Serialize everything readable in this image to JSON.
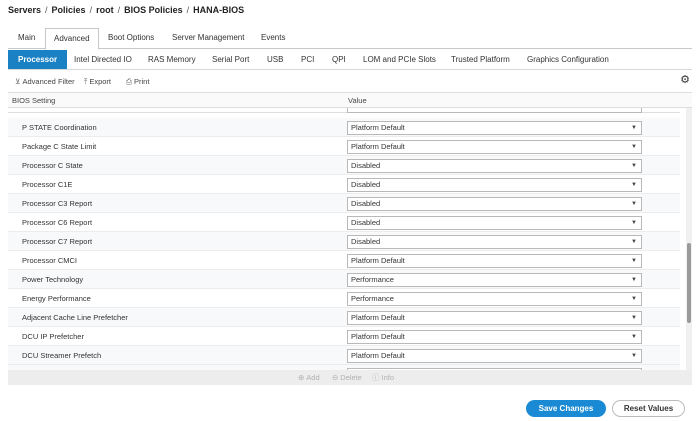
{
  "breadcrumb": [
    "Servers",
    "Policies",
    "root",
    "BIOS Policies",
    "HANA-BIOS"
  ],
  "breadcrumb_sep": "/",
  "main_tabs": [
    {
      "label": "Main"
    },
    {
      "label": "Advanced",
      "active": true
    },
    {
      "label": "Boot Options"
    },
    {
      "label": "Server Management"
    },
    {
      "label": "Events"
    }
  ],
  "sub_tabs": [
    {
      "label": "Processor",
      "active": true
    },
    {
      "label": "Intel Directed IO"
    },
    {
      "label": "RAS Memory"
    },
    {
      "label": "Serial Port"
    },
    {
      "label": "USB"
    },
    {
      "label": "PCI"
    },
    {
      "label": "QPI"
    },
    {
      "label": "LOM and PCIe Slots"
    },
    {
      "label": "Trusted Platform"
    },
    {
      "label": "Graphics Configuration"
    }
  ],
  "toolbar": {
    "advanced_filter": "Advanced Filter",
    "export": "Export",
    "print": "Print",
    "gear_icon": "⚙"
  },
  "table": {
    "headers": {
      "setting": "BIOS Setting",
      "value": "Value"
    },
    "rows": [
      {
        "setting": "P STATE Coordination",
        "value": "Platform Default"
      },
      {
        "setting": "Package C State Limit",
        "value": "Platform Default"
      },
      {
        "setting": "Processor C State",
        "value": "Disabled"
      },
      {
        "setting": "Processor C1E",
        "value": "Disabled"
      },
      {
        "setting": "Processor C3 Report",
        "value": "Disabled"
      },
      {
        "setting": "Processor C6 Report",
        "value": "Disabled"
      },
      {
        "setting": "Processor C7 Report",
        "value": "Disabled"
      },
      {
        "setting": "Processor CMCI",
        "value": "Platform Default"
      },
      {
        "setting": "Power Technology",
        "value": "Performance"
      },
      {
        "setting": "Energy Performance",
        "value": "Performance"
      },
      {
        "setting": "Adjacent Cache Line Prefetcher",
        "value": "Platform Default"
      },
      {
        "setting": "DCU IP Prefetcher",
        "value": "Platform Default"
      },
      {
        "setting": "DCU Streamer Prefetch",
        "value": "Platform Default"
      }
    ]
  },
  "footer_actions": {
    "add": "Add",
    "delete": "Delete",
    "info": "Info"
  },
  "buttons": {
    "save": "Save Changes",
    "reset": "Reset Values"
  },
  "colors": {
    "accent": "#1a82c4",
    "primary_button": "#1a8ad4"
  }
}
